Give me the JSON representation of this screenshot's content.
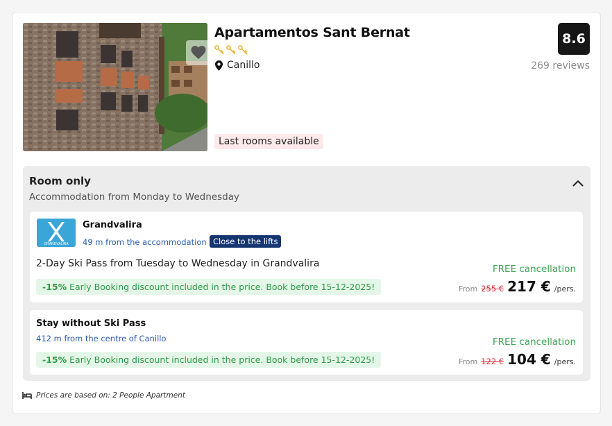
{
  "hotel": {
    "name": "Apartamentos Sant Bernat",
    "location": "Canillo",
    "score": "8.6",
    "reviews": "269 reviews",
    "key_rating": 3,
    "availability_badge": "Last rooms available"
  },
  "panel": {
    "title": "Room only",
    "subtitle": "Accommodation from Monday to Wednesday"
  },
  "options": [
    {
      "name": "Grandvalira",
      "distance": "49 m from the accommodation",
      "badge": "Close to the lifts",
      "description": "2-Day Ski Pass from Tuesday to Wednesday in Grandvalira",
      "discount_pct": "-15%",
      "discount_text": "Early Booking discount included in the price. Book before 15-12-2025!",
      "cancellation": "FREE cancellation",
      "from": "From",
      "old_price": "255 €",
      "price": "217 €",
      "per": "/pers.",
      "logo_text": "GRANDVALIRA"
    },
    {
      "name": "Stay without Ski Pass",
      "distance": "412 m from the centre of Canillo",
      "discount_pct": "-15%",
      "discount_text": "Early Booking discount included in the price. Book before 15-12-2025!",
      "cancellation": "FREE cancellation",
      "from": "From",
      "old_price": "122 €",
      "price": "104 €",
      "per": "/pers."
    }
  ],
  "footnote": "Prices are based on: 2 People Apartment",
  "colors": {
    "score_bg": "#161616",
    "badge_bg": "#153570",
    "discount_green": "#2e9b48",
    "old_price_red": "#d9303b",
    "link_blue": "#2a5db0"
  },
  "icons": [
    "heart-icon",
    "key-icon",
    "map-pin-icon",
    "chevron-up-icon",
    "bed-icon"
  ]
}
